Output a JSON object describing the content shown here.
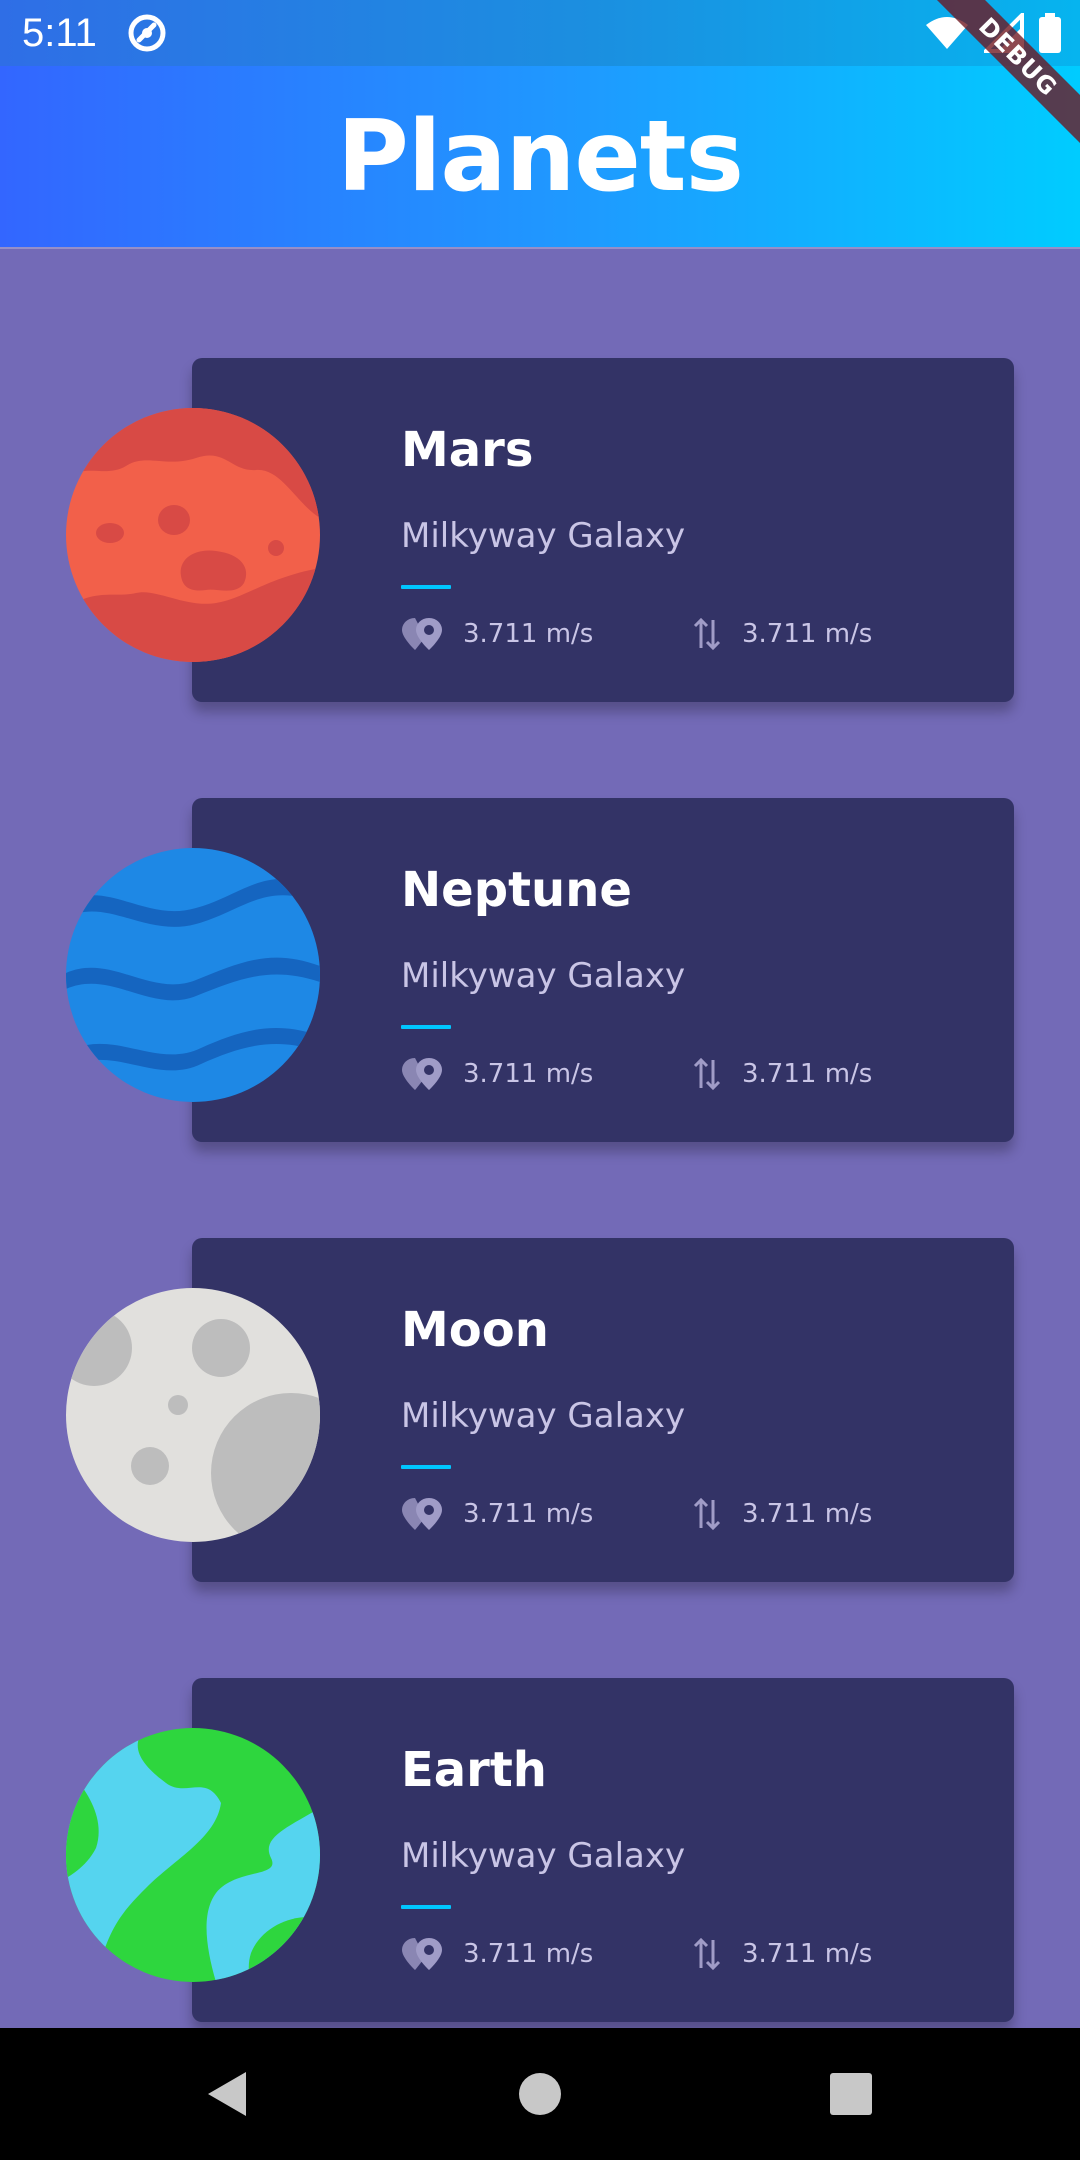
{
  "status_bar": {
    "time": "5:11",
    "app_icon": "app-notification-icon",
    "icons": [
      "wifi-icon",
      "signal-icon",
      "battery-icon"
    ]
  },
  "debug_banner": {
    "label": "DEBUG"
  },
  "header": {
    "title": "Planets"
  },
  "colors": {
    "background": "#736AB7",
    "card": "#333366",
    "header_gradient_start": "#3366FF",
    "header_gradient_end": "#00CCFF",
    "accent_separator": "#00C6FF",
    "subtitle_text": "#C9C5E6"
  },
  "planets": [
    {
      "name": "Mars",
      "location": "Milkyway Galaxy",
      "distance": "3.711 m/s",
      "gravity": "3.711 m/s",
      "image": "mars-planet-image"
    },
    {
      "name": "Neptune",
      "location": "Milkyway Galaxy",
      "distance": "3.711 m/s",
      "gravity": "3.711 m/s",
      "image": "neptune-planet-image"
    },
    {
      "name": "Moon",
      "location": "Milkyway Galaxy",
      "distance": "3.711 m/s",
      "gravity": "3.711 m/s",
      "image": "moon-planet-image"
    },
    {
      "name": "Earth",
      "location": "Milkyway Galaxy",
      "distance": "3.711 m/s",
      "gravity": "3.711 m/s",
      "image": "earth-planet-image"
    }
  ],
  "nav_bar": {
    "buttons": [
      "back-icon",
      "home-icon",
      "recents-icon"
    ]
  }
}
